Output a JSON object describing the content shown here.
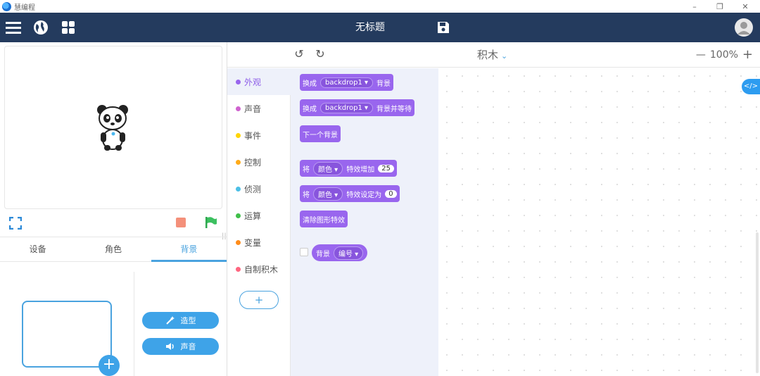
{
  "window": {
    "title": "慧编程",
    "minimize": "–",
    "restore": "❐",
    "close": "✕"
  },
  "header": {
    "doc_title": "无标题"
  },
  "stage_tabs": [
    "设备",
    "角色",
    "背景"
  ],
  "side_buttons": {
    "costume": "造型",
    "sound": "声音"
  },
  "add_backdrop": "+",
  "toolbar": {
    "undo": "↺",
    "redo": "↻",
    "mode": "积木",
    "mode_caret": "⌄",
    "zoom_out": "—",
    "zoom": "100%",
    "zoom_in": "+"
  },
  "categories": [
    {
      "label": "外观",
      "color": "#9966ee"
    },
    {
      "label": "声音",
      "color": "#cf63cf"
    },
    {
      "label": "事件",
      "color": "#ffd500"
    },
    {
      "label": "控制",
      "color": "#ffab19"
    },
    {
      "label": "侦测",
      "color": "#4cbfe6"
    },
    {
      "label": "运算",
      "color": "#40bf4a"
    },
    {
      "label": "变量",
      "color": "#ff8c1a"
    },
    {
      "label": "自制积木",
      "color": "#ff6680"
    }
  ],
  "add_extension": "+",
  "blocks": {
    "b1": {
      "prefix": "换成",
      "dropdown": "backdrop1 ▾",
      "suffix": "背景"
    },
    "b2": {
      "prefix": "换成",
      "dropdown": "backdrop1 ▾",
      "suffix": "背景并等待"
    },
    "b3": {
      "text": "下一个背景"
    },
    "b4": {
      "prefix": "将",
      "dropdown": "颜色 ▾",
      "middle": "特效增加",
      "value": "25"
    },
    "b5": {
      "prefix": "将",
      "dropdown": "颜色 ▾",
      "middle": "特效设定为",
      "value": "0"
    },
    "b6": {
      "text": "清除图形特效"
    },
    "b7": {
      "text": "背景",
      "dropdown": "编号 ▾"
    }
  },
  "code_toggle": "</>"
}
